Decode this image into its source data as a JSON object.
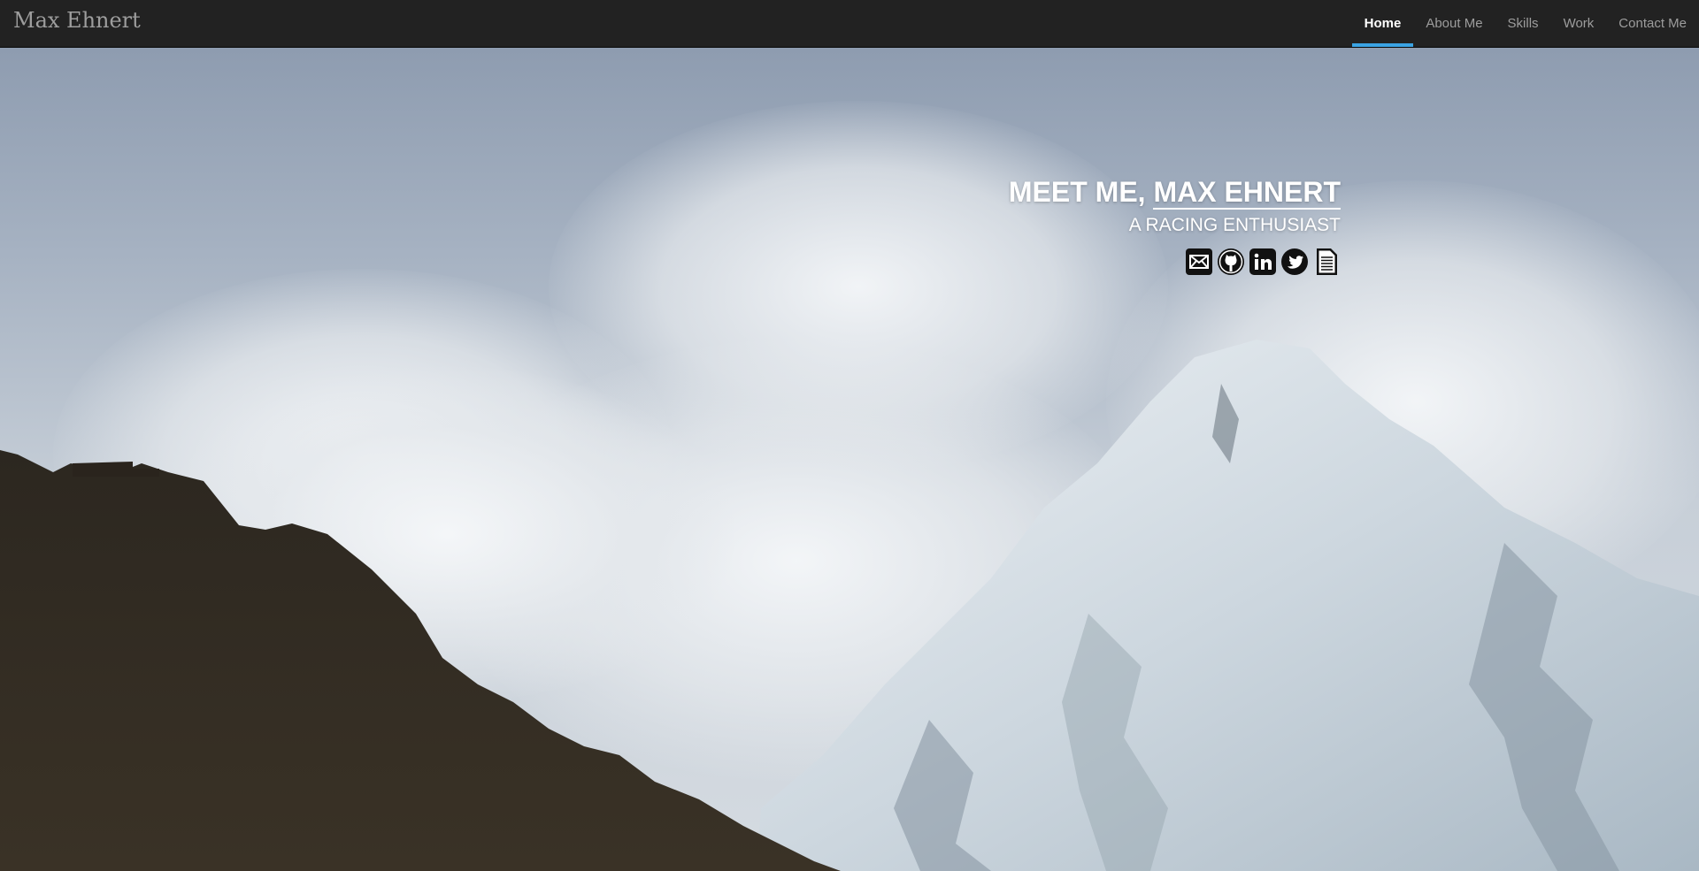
{
  "navbar": {
    "brand": "Max Ehnert",
    "items": [
      {
        "label": "Home",
        "active": true
      },
      {
        "label": "About Me",
        "active": false
      },
      {
        "label": "Skills",
        "active": false
      },
      {
        "label": "Work",
        "active": false
      },
      {
        "label": "Contact Me",
        "active": false
      }
    ]
  },
  "hero": {
    "headline_prefix": "MEET ME, ",
    "headline_name": "MAX EHNERT",
    "subtitle": "A RACING ENTHUSIAST",
    "social_icons": [
      "email-icon",
      "github-icon",
      "linkedin-icon",
      "twitter-icon",
      "resume-icon"
    ]
  },
  "colors": {
    "navbar_bg": "#222222",
    "nav_text": "#9d9d9d",
    "nav_active_text": "#ffffff",
    "nav_active_accent": "#3aa3e3",
    "headline_text": "#ffffff"
  }
}
